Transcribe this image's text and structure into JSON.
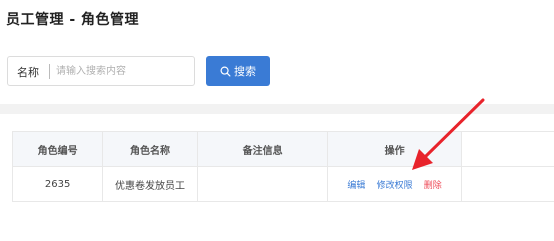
{
  "header": {
    "title": "员工管理 - 角色管理"
  },
  "search": {
    "label": "名称",
    "placeholder": "请输入搜索内容",
    "value": "",
    "button_label": "搜索",
    "button_icon": "search-icon"
  },
  "table": {
    "columns": [
      "角色编号",
      "角色名称",
      "备注信息",
      "操作"
    ],
    "rows": [
      {
        "id": "2635",
        "name": "优惠卷发放员工",
        "note": "",
        "actions": {
          "edit": "编辑",
          "permissions": "修改权限",
          "delete": "删除"
        }
      }
    ]
  },
  "colors": {
    "primary": "#3a7bd5",
    "danger": "#ee4d5a",
    "annotation": "#e8232b"
  }
}
